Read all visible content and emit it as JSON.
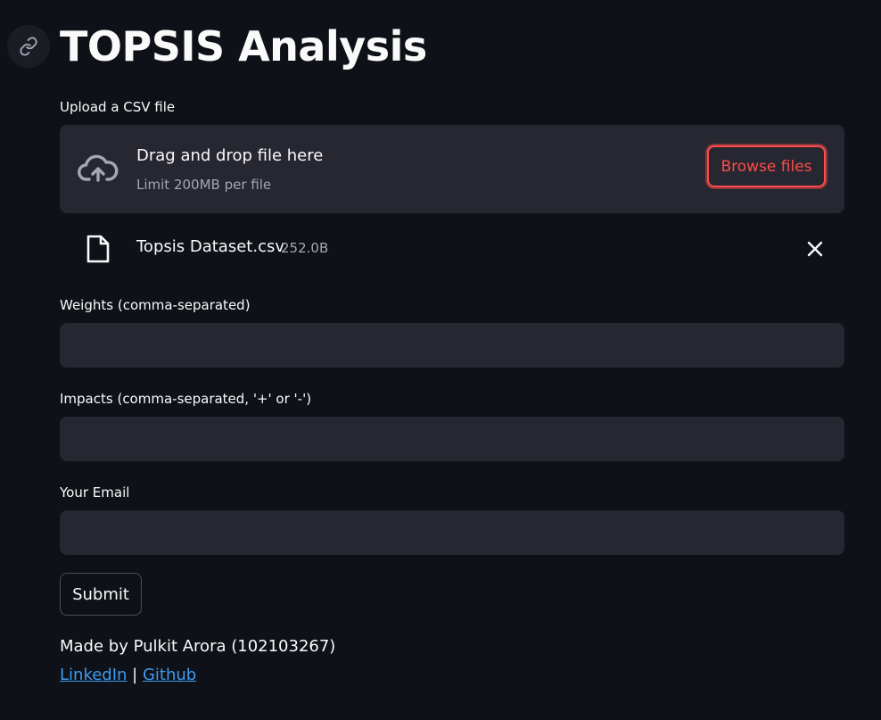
{
  "page": {
    "title": "TOPSIS Analysis"
  },
  "uploader": {
    "label": "Upload a CSV file",
    "drop_title": "Drag and drop file here",
    "drop_limit": "Limit 200MB per file",
    "browse_label": "Browse files",
    "file": {
      "name": "Topsis Dataset.csv",
      "size": "252.0B"
    }
  },
  "form": {
    "weights_label": "Weights (comma-separated)",
    "weights_value": "",
    "impacts_label": "Impacts (comma-separated, '+' or '-')",
    "impacts_value": "",
    "email_label": "Your Email",
    "email_value": "",
    "submit_label": "Submit"
  },
  "footer": {
    "credit": "Made by Pulkit Arora (102103267)",
    "linkedin_label": "LinkedIn",
    "separator": "|",
    "github_label": "Github"
  },
  "icons": {
    "anchor": "link-icon",
    "upload": "cloud-upload-icon",
    "file": "file-icon",
    "remove": "close-icon"
  },
  "colors": {
    "background": "#0e1117",
    "surface": "#262730",
    "accent": "#ff4b4b",
    "link": "#3d9df3",
    "muted_text": "#a3a8b4"
  }
}
